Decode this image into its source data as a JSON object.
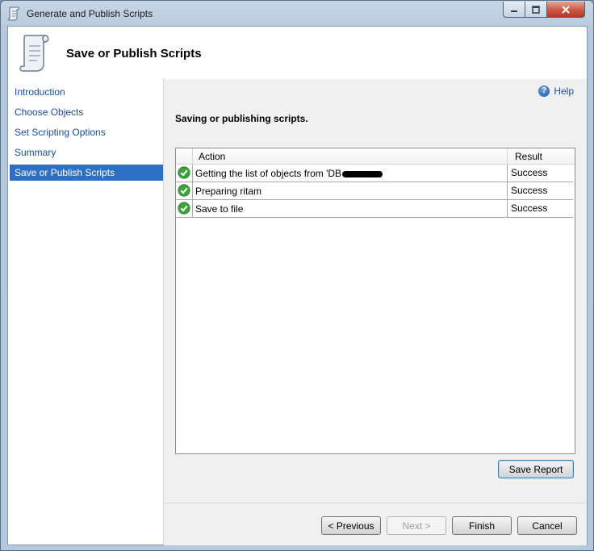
{
  "window": {
    "title": "Generate and Publish Scripts"
  },
  "header": {
    "title": "Save or Publish Scripts"
  },
  "nav": {
    "items": [
      {
        "label": "Introduction",
        "selected": false
      },
      {
        "label": "Choose Objects",
        "selected": false
      },
      {
        "label": "Set Scripting Options",
        "selected": false
      },
      {
        "label": "Summary",
        "selected": false
      },
      {
        "label": "Save or Publish Scripts",
        "selected": true
      }
    ]
  },
  "main": {
    "help_label": "Help",
    "subtitle": "Saving or publishing scripts.",
    "grid": {
      "columns": {
        "action": "Action",
        "result": "Result"
      },
      "rows": [
        {
          "action": "Getting the list of objects from 'DB",
          "result": "Success",
          "status_icon": "success-check-icon"
        },
        {
          "action": "Preparing ritam",
          "result": "Success",
          "status_icon": "success-check-icon"
        },
        {
          "action": "Save to file",
          "result": "Success",
          "status_icon": "success-check-icon"
        }
      ]
    },
    "save_report_label": "Save Report"
  },
  "footer": {
    "previous_label": "< Previous",
    "next_label": "Next >",
    "finish_label": "Finish",
    "cancel_label": "Cancel"
  },
  "colors": {
    "selection": "#2d6fc3",
    "link": "#1a4d94",
    "success": "#3ea33a"
  }
}
